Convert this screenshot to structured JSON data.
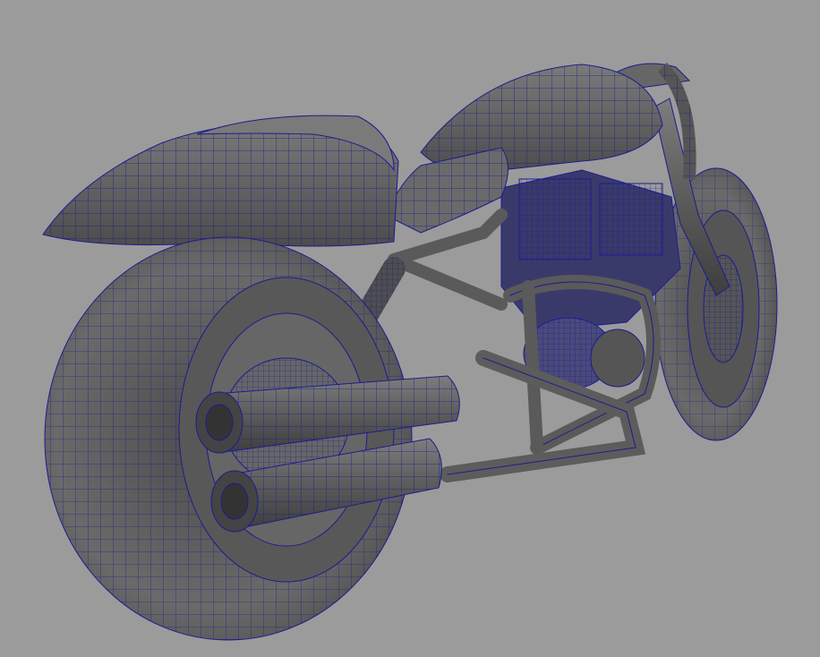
{
  "viewport": {
    "background_color": "#9b9b9b",
    "shading_mode": "wireframe-on-shaded",
    "wire_color": "#1a1a8c",
    "surface_color": "#5d5d5d",
    "subject": "motorcycle-model"
  }
}
